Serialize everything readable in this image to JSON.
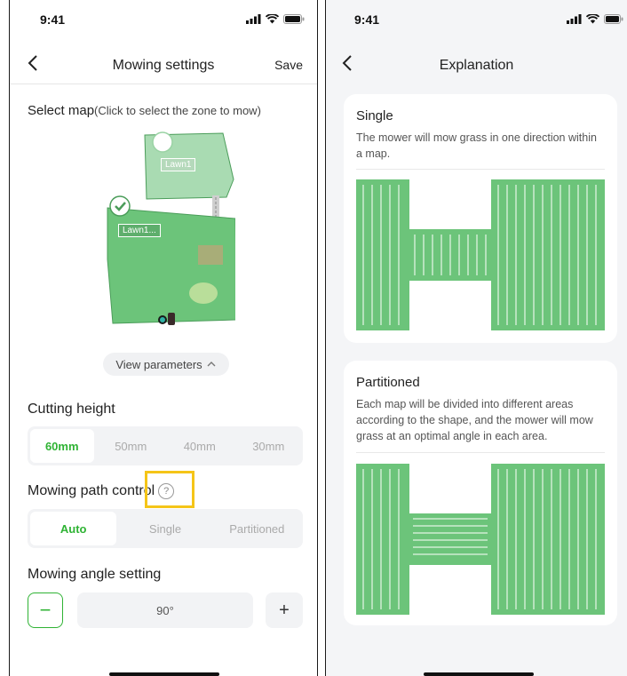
{
  "left": {
    "status_time": "9:41",
    "nav": {
      "title": "Mowing settings",
      "save_label": "Save"
    },
    "select_map": {
      "title": "Select map",
      "subtitle": "(Click to select the zone to mow)"
    },
    "map": {
      "zone_upper_label": "Lawn1",
      "zone_lower_label": "Lawn1..."
    },
    "view_parameters_label": "View parameters",
    "cutting_height": {
      "label": "Cutting height",
      "options": [
        "60mm",
        "50mm",
        "40mm",
        "30mm"
      ],
      "selected": "60mm"
    },
    "path_control": {
      "label": "Mowing path control",
      "help_glyph": "?",
      "options": [
        "Auto",
        "Single",
        "Partitioned"
      ],
      "selected": "Auto"
    },
    "angle": {
      "label": "Mowing angle setting",
      "value": "90°",
      "minus": "−",
      "plus": "+"
    }
  },
  "right": {
    "status_time": "9:41",
    "nav": {
      "title": "Explanation"
    },
    "single": {
      "title": "Single",
      "description": "The mower will mow grass in one direction within a map."
    },
    "partitioned": {
      "title": "Partitioned",
      "description": "Each map will be divided into different areas according to the shape, and the mower will mow grass at an optimal angle in each area."
    }
  },
  "colors": {
    "accent": "#2fb334",
    "lawn_fill": "#6cc47a",
    "highlight": "#f5c518"
  },
  "icons": [
    "back-chevron-icon",
    "signal-icon",
    "wifi-icon",
    "battery-icon",
    "check-icon",
    "mower-icon",
    "chevron-up-icon",
    "help-icon"
  ]
}
